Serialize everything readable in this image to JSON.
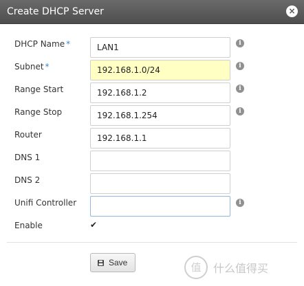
{
  "dialog": {
    "title": "Create DHCP Server",
    "close_glyph": "×"
  },
  "fields": [
    {
      "label": "DHCP Name",
      "required": true,
      "value": "LAN1",
      "info": true
    },
    {
      "label": "Subnet",
      "required": true,
      "value": "192.168.1.0/24",
      "info": true
    },
    {
      "label": "Range Start",
      "required": false,
      "value": "192.168.1.2",
      "info": true
    },
    {
      "label": "Range Stop",
      "required": false,
      "value": "192.168.1.254",
      "info": true
    },
    {
      "label": "Router",
      "required": false,
      "value": "192.168.1.1",
      "info": false
    },
    {
      "label": "DNS 1",
      "required": false,
      "value": "",
      "info": false
    },
    {
      "label": "DNS 2",
      "required": false,
      "value": "",
      "info": false
    },
    {
      "label": "Unifi Controller",
      "required": false,
      "value": "",
      "info": true
    }
  ],
  "required_mark": "*",
  "info_glyph": "i",
  "enable": {
    "label": "Enable",
    "checked": true,
    "check_glyph": "✔"
  },
  "save_button": {
    "label": "Save",
    "icon": "floppy-disk-icon"
  },
  "watermark": {
    "logo_glyph": "值",
    "text": "什么值得买"
  },
  "colors": {
    "titlebar": "#5a5a5a",
    "required": "#3a87c8",
    "highlight": "#ffffc4"
  }
}
